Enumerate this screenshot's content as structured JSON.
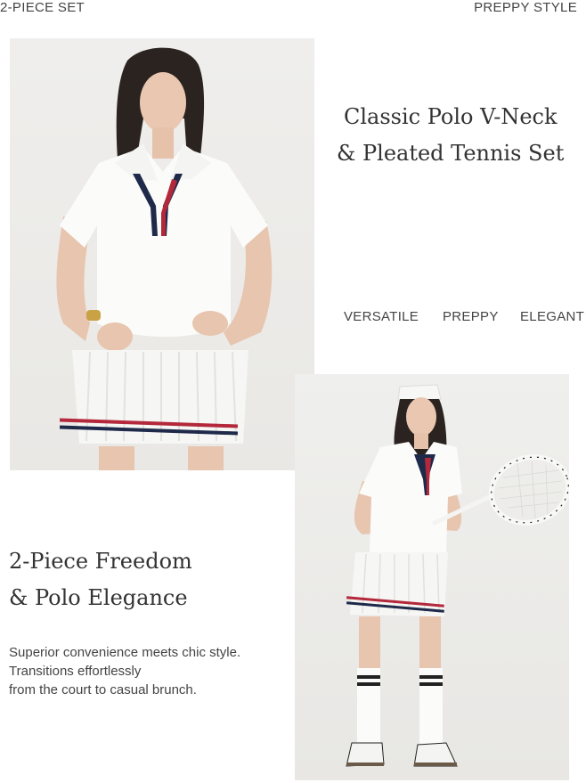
{
  "top": {
    "left_label": "2-PIECE SET",
    "right_label": "PREPPY STYLE"
  },
  "headline1": {
    "line1": "Classic Polo V-Neck",
    "line2": "& Pleated Tennis Set"
  },
  "tags": [
    "VERSATILE",
    "PREPPY",
    "ELEGANT"
  ],
  "headline2": {
    "line1": "2-Piece Freedom",
    "line2": "& Polo Elegance"
  },
  "description": {
    "line1": "Superior convenience meets chic style.",
    "line2": "Transitions effortlessly",
    "line3": "from the court to casual brunch."
  },
  "colors": {
    "navy_stripe": "#1f2a4a",
    "red_stripe": "#b3283a",
    "background": "#ffffff",
    "photo_bg": "#ebeae7"
  }
}
